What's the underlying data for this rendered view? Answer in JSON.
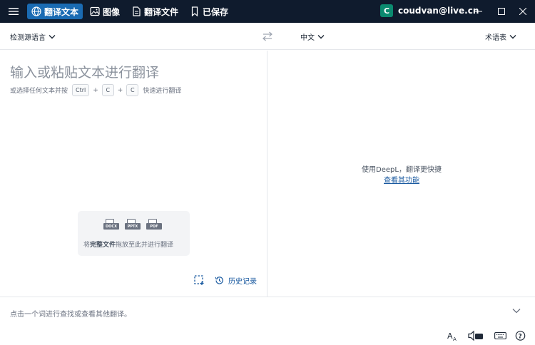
{
  "titlebar": {
    "tabs": [
      {
        "label": "翻译文本",
        "icon": "globe-icon",
        "active": true
      },
      {
        "label": "图像",
        "icon": "image-icon",
        "active": false
      },
      {
        "label": "翻译文件",
        "icon": "file-icon",
        "active": false
      },
      {
        "label": "已保存",
        "icon": "bookmark-icon",
        "active": false
      }
    ],
    "user": {
      "initial": "C",
      "email": "coudvan@live.cn"
    },
    "colors": {
      "bar": "#0f1b2d",
      "active_tab": "#1a6bb3",
      "avatar": "#0b8a6f"
    }
  },
  "langbar": {
    "source_lang": "检测源语言",
    "target_lang": "中文",
    "glossary": "术语表"
  },
  "source": {
    "placeholder": "输入或粘贴文本进行翻译",
    "hint_prefix": "或选择任何文本并按",
    "keys": [
      "Ctrl",
      "C",
      "C"
    ],
    "hint_suffix": "快速进行翻译",
    "drop": {
      "file_types": [
        "DOCX",
        "PPTX",
        "PDF"
      ],
      "text_before": "将",
      "text_bold": "完整文件",
      "text_after": "拖放至此并进行翻译"
    },
    "history_label": "历史记录"
  },
  "target": {
    "promo_text": "使用DeepL，翻译更快捷",
    "promo_link": "查看其功能"
  },
  "dictionary": {
    "prompt": "点击一个词进行查找或查看其他翻译。"
  }
}
